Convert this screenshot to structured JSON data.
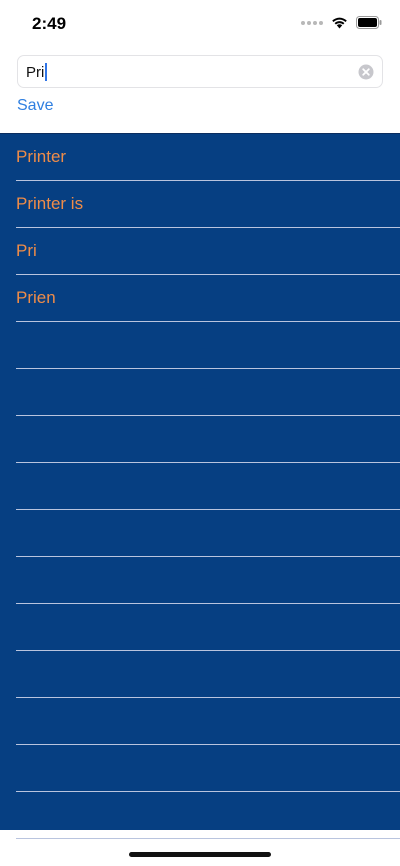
{
  "status_bar": {
    "time": "2:49"
  },
  "search": {
    "value": "Pri"
  },
  "save_label": "Save",
  "list": {
    "items": [
      "Printer",
      "Printer is",
      "Pri",
      "Prien",
      "",
      "",
      "",
      "",
      "",
      "",
      "",
      "",
      "",
      "",
      ""
    ]
  },
  "colors": {
    "list_background": "#063f82",
    "item_text": "#ef8c48",
    "save_link": "#2f7fe0",
    "separator": "#b9c4de"
  }
}
